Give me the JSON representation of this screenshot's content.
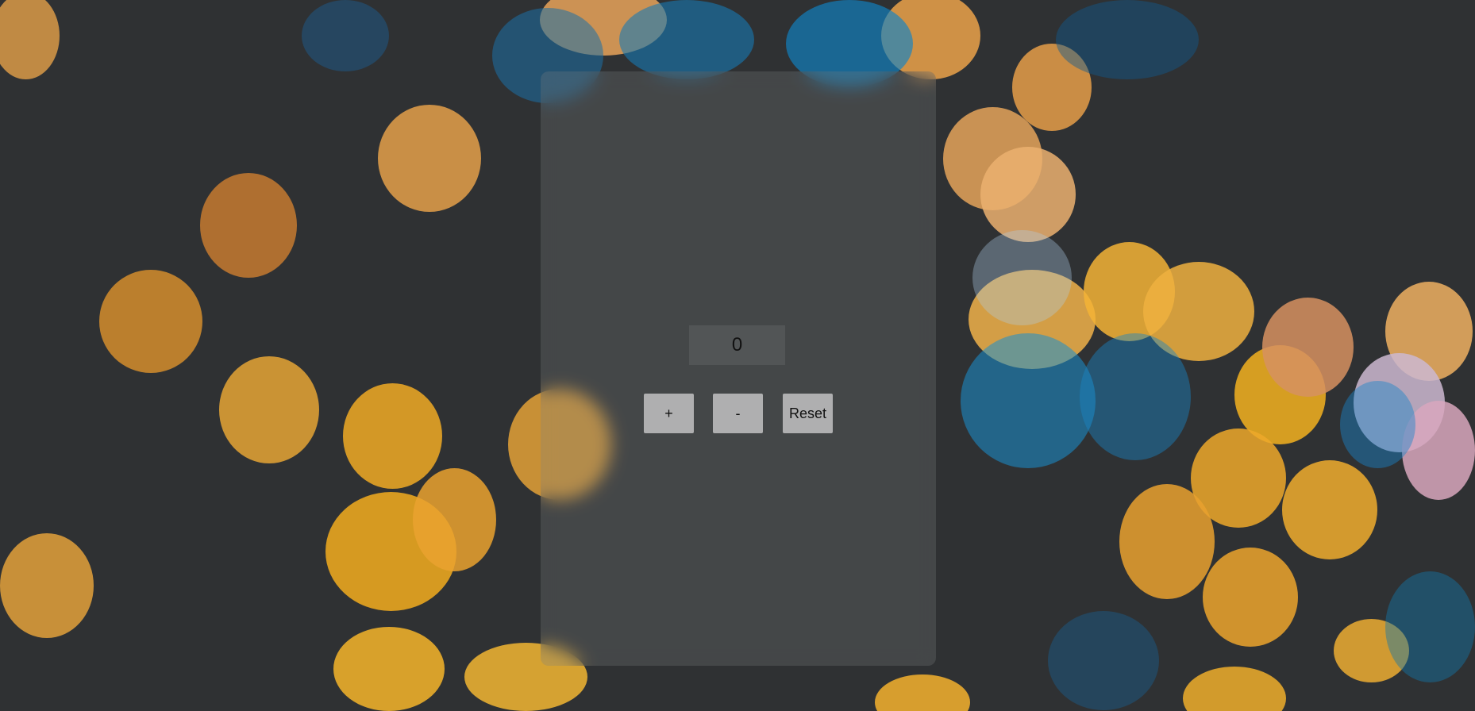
{
  "counter": {
    "value": "0"
  },
  "buttons": {
    "increment": "+",
    "decrement": "-",
    "reset": "Reset"
  }
}
